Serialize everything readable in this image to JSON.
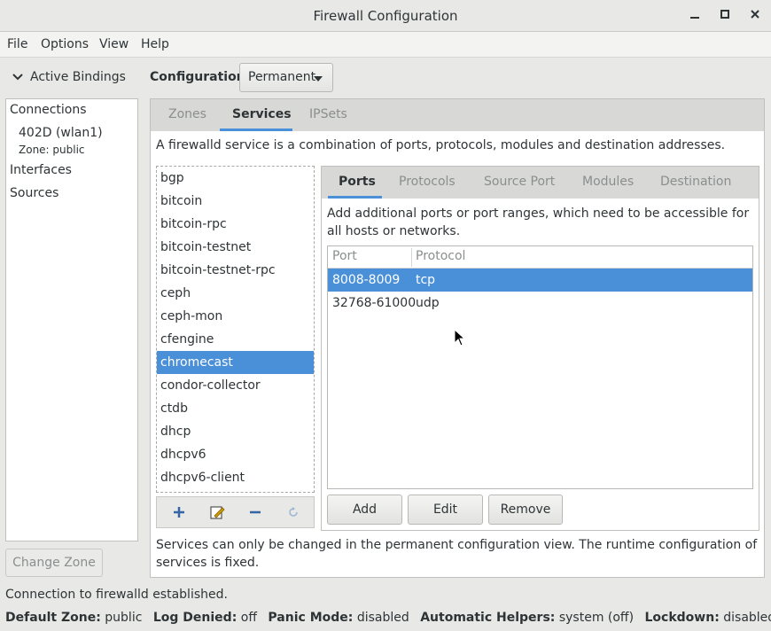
{
  "window": {
    "title": "Firewall Configuration",
    "minimize": "–",
    "maximize": "□",
    "close": "×"
  },
  "menubar": {
    "items": [
      "File",
      "Options",
      "View",
      "Help"
    ]
  },
  "sidebar": {
    "toggle_label": "Active Bindings",
    "connections_heading": "Connections",
    "connection_name": "402D (wlan1)",
    "connection_zone": "Zone: public",
    "interfaces_heading": "Interfaces",
    "sources_heading": "Sources",
    "change_zone_button": "Change Zone"
  },
  "configuration": {
    "label": "Configuration:",
    "value": "Permanent"
  },
  "outer_tabs": [
    "Zones",
    "Services",
    "IPSets"
  ],
  "services": {
    "description": "A firewalld service is a combination of ports, protocols, modules and destination addresses.",
    "list": [
      "bgp",
      "bitcoin",
      "bitcoin-rpc",
      "bitcoin-testnet",
      "bitcoin-testnet-rpc",
      "ceph",
      "ceph-mon",
      "cfengine",
      "chromecast",
      "condor-collector",
      "ctdb",
      "dhcp",
      "dhcpv6",
      "dhcpv6-client"
    ],
    "selected": "chromecast",
    "note": "Services can only be changed in the permanent configuration view. The runtime configuration of services is fixed."
  },
  "inner_tabs": [
    "Ports",
    "Protocols",
    "Source Port",
    "Modules",
    "Destination"
  ],
  "ports": {
    "description": "Add additional ports or port ranges, which need to be accessible for all hosts or networks.",
    "columns": [
      "Port",
      "Protocol"
    ],
    "rows": [
      {
        "port": "8008-8009",
        "protocol": "tcp"
      },
      {
        "port": "32768-61000",
        "protocol": "udp"
      }
    ],
    "buttons": {
      "add": "Add",
      "edit": "Edit",
      "remove": "Remove"
    }
  },
  "status": {
    "message": "Connection to firewalld established.",
    "default_zone_label": "Default Zone:",
    "default_zone": "public",
    "log_denied_label": "Log Denied:",
    "log_denied": "off",
    "panic_mode_label": "Panic Mode:",
    "panic_mode": "disabled",
    "helpers_label": "Automatic Helpers:",
    "helpers": "system (off)",
    "lockdown_label": "Lockdown:",
    "lockdown": "disabled"
  },
  "colors": {
    "accent": "#4a90d9",
    "background": "#e8e8e7",
    "insensitive": "#8b8e8f"
  }
}
